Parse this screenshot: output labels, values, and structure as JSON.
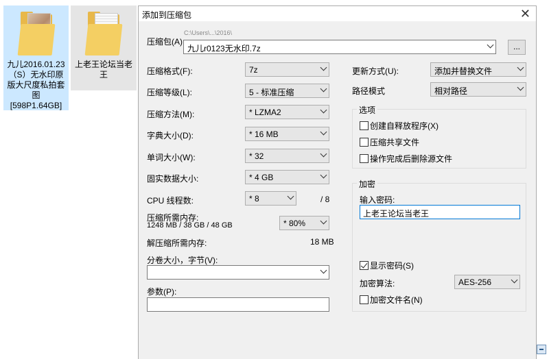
{
  "desktop": {
    "items": [
      {
        "label": "九儿2016.01.23（S）无水印原版大尺度私拍套图[598P1.64GB]"
      },
      {
        "label": "上老王论坛当老王"
      }
    ]
  },
  "dialog": {
    "title": "添加到压缩包",
    "archive": {
      "label": "压缩包(A)",
      "path_hint": "C:\\Users\\...\\2016\\",
      "value": "九儿r0123无水印.7z",
      "browse_label": "..."
    },
    "format": {
      "label": "压缩格式(F):",
      "value": "7z"
    },
    "level": {
      "label": "压缩等级(L):",
      "value": "5 - 标准压缩"
    },
    "method": {
      "label": "压缩方法(M):",
      "value": "* LZMA2"
    },
    "dict": {
      "label": "字典大小(D):",
      "value": "* 16 MB"
    },
    "word": {
      "label": "单词大小(W):",
      "value": "* 32"
    },
    "solid": {
      "label": "固实数据大小:",
      "value": "* 4 GB"
    },
    "threads": {
      "label": "CPU 线程数:",
      "value": "* 8",
      "max": "/ 8"
    },
    "mem_compress": {
      "label": "压缩所需内存:",
      "detail": "1248 MB / 38 GB / 48 GB",
      "value": "* 80%"
    },
    "mem_decompress": {
      "label": "解压缩所需内存:",
      "value": "18 MB"
    },
    "split": {
      "label": "分卷大小，字节(V):",
      "value": ""
    },
    "params": {
      "label": "参数(P):",
      "value": ""
    },
    "update": {
      "label": "更新方式(U):",
      "value": "添加并替换文件"
    },
    "pathmode": {
      "label": "路径模式",
      "value": "相对路径"
    },
    "options": {
      "title": "选项",
      "items": [
        {
          "label": "创建自释放程序(X)",
          "checked": false
        },
        {
          "label": "压缩共享文件",
          "checked": false
        },
        {
          "label": "操作完成后删除源文件",
          "checked": false
        }
      ]
    },
    "encryption": {
      "title": "加密",
      "password_label": "输入密码:",
      "password_value": "上老王论坛当老王",
      "show_password": {
        "label": "显示密码(S)",
        "checked": true
      },
      "method_label": "加密算法:",
      "method_value": "AES-256",
      "encrypt_names": {
        "label": "加密文件名(N)",
        "checked": false
      }
    }
  }
}
